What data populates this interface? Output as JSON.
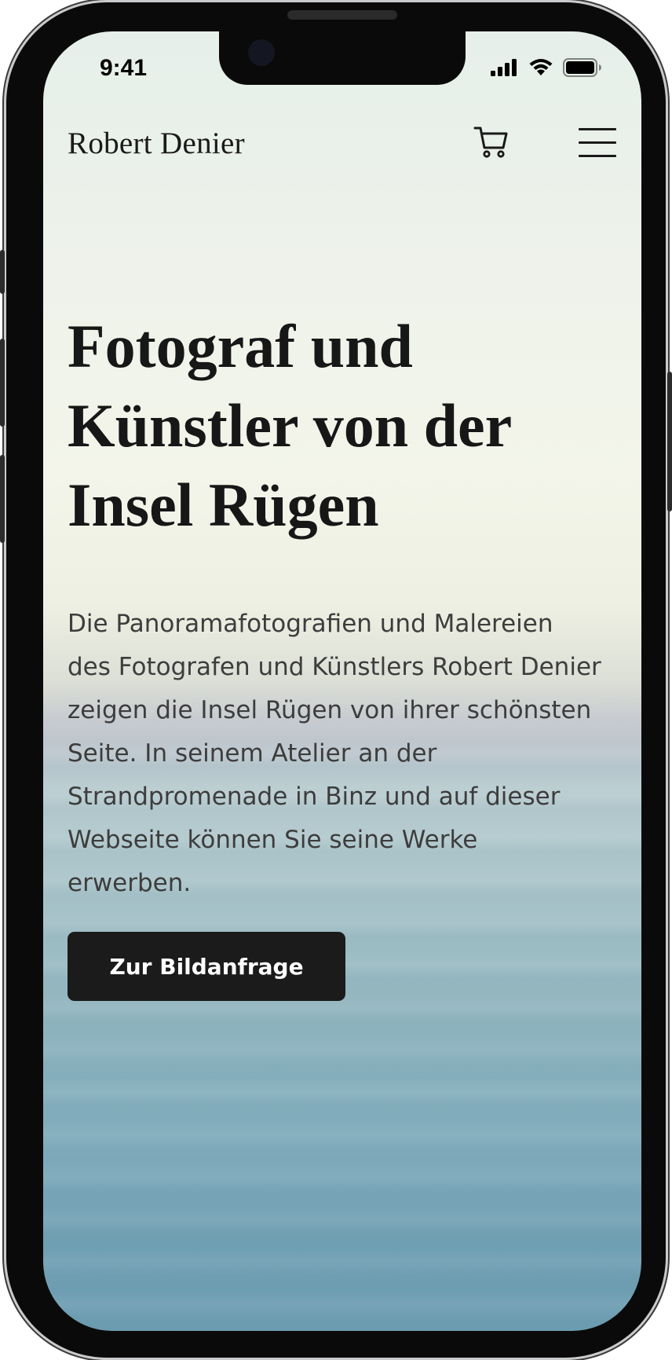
{
  "status_bar": {
    "time": "9:41",
    "icons": [
      "cellular-signal-icon",
      "wifi-icon",
      "battery-icon"
    ]
  },
  "header": {
    "site_title": "Robert Denier",
    "icons": [
      "cart-icon",
      "hamburger-menu-icon"
    ]
  },
  "hero": {
    "heading": "Fotograf und Künstler von der Insel Rügen",
    "description": "Die Panoramafotografien und Malereien des Fotografen und Künstlers Robert Denier zeigen die Insel Rügen von ihrer schönsten Seite. In seinem Atelier an der Strandpromenade in Binz und auf dieser Webseite können Sie seine Werke erwerben.",
    "cta_label": "Zur Bildanfrage"
  },
  "colors": {
    "text_dark": "#171717",
    "button_bg": "#1b1b1b",
    "button_text": "#ffffff",
    "sea": "#6b9bb0"
  }
}
